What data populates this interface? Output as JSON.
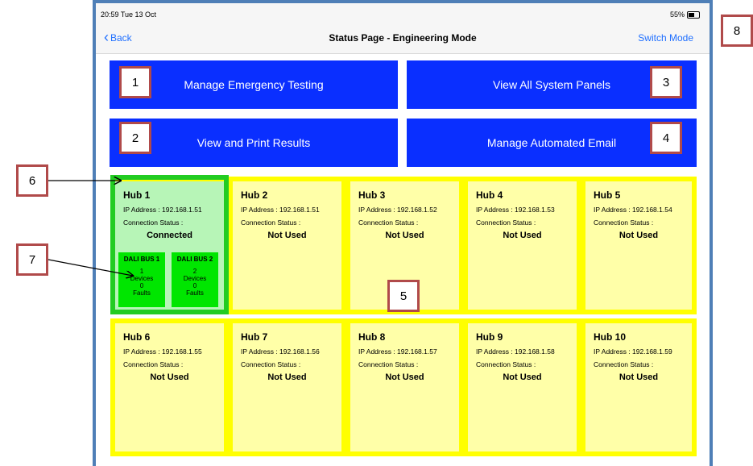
{
  "status_bar": {
    "time": "20:59  Tue 13 Oct",
    "battery": "55%"
  },
  "nav": {
    "back_label": "Back",
    "title": "Status Page - Engineering Mode",
    "switch_label": "Switch Mode"
  },
  "actions": {
    "manage_emergency": "Manage Emergency Testing",
    "view_panels": "View All System Panels",
    "view_print": "View and Print Results",
    "manage_email": "Manage Automated Email"
  },
  "hub_labels": {
    "ip_prefix": "IP Address : ",
    "conn_label": "Connection Status :"
  },
  "hubs_row1": [
    {
      "name": "Hub 1",
      "ip": "192.168.1.51",
      "status": "Connected"
    },
    {
      "name": "Hub 2",
      "ip": "192.168.1.51",
      "status": "Not Used"
    },
    {
      "name": "Hub 3",
      "ip": "192.168.1.52",
      "status": "Not Used"
    },
    {
      "name": "Hub 4",
      "ip": "192.168.1.53",
      "status": "Not Used"
    },
    {
      "name": "Hub 5",
      "ip": "192.168.1.54",
      "status": "Not Used"
    }
  ],
  "hubs_row2": [
    {
      "name": "Hub 6",
      "ip": "192.168.1.55",
      "status": "Not Used"
    },
    {
      "name": "Hub 7",
      "ip": "192.168.1.56",
      "status": "Not Used"
    },
    {
      "name": "Hub 8",
      "ip": "192.168.1.57",
      "status": "Not Used"
    },
    {
      "name": "Hub 9",
      "ip": "192.168.1.58",
      "status": "Not Used"
    },
    {
      "name": "Hub 10",
      "ip": "192.168.1.59",
      "status": "Not Used"
    }
  ],
  "dali_buses": [
    {
      "name": "DALI BUS 1",
      "devices": "1",
      "devices_label": "Devices",
      "faults": "0",
      "faults_label": "Faults"
    },
    {
      "name": "DALI BUS 2",
      "devices": "2",
      "devices_label": "Devices",
      "faults": "0",
      "faults_label": "Faults"
    }
  ],
  "annotations": [
    "1",
    "2",
    "3",
    "4",
    "5",
    "6",
    "7",
    "8"
  ],
  "colors": {
    "button_blue": "#0a2fff",
    "link_blue": "#1f6fff",
    "hub_yellow": "#ffff00",
    "hub_cell": "#ffffa8",
    "connected_green": "#22cc22",
    "bus_green": "#00e600",
    "annotation_border": "#b04a4a"
  }
}
